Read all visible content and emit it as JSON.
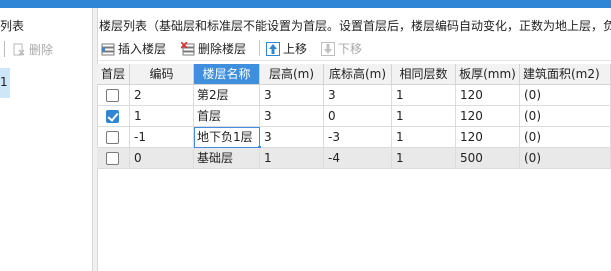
{
  "left_panel": {
    "title": "列表",
    "delete_label": "删除",
    "selected_item": "1"
  },
  "right_panel": {
    "title": "楼层列表（基础层和标准层不能设置为首层。设置首层后，楼层编码自动变化，正数为地上层，负"
  },
  "toolbar": {
    "insert_label": "插入楼层",
    "delete_label": "删除楼层",
    "move_up_label": "上移",
    "move_down_label": "下移"
  },
  "grid": {
    "columns": [
      "首层",
      "编码",
      "楼层名称",
      "层高(m)",
      "底标高(m)",
      "相同层数",
      "板厚(mm)",
      "建筑面积(m2)"
    ],
    "selected_column": "楼层名称",
    "rows": [
      {
        "first_floor": false,
        "code": "2",
        "name": "第2层",
        "height": "3",
        "bottom_elev": "3",
        "same_count": "1",
        "slab": "120",
        "area": "(0)"
      },
      {
        "first_floor": true,
        "code": "1",
        "name": "首层",
        "height": "3",
        "bottom_elev": "0",
        "same_count": "1",
        "slab": "120",
        "area": "(0)"
      },
      {
        "first_floor": false,
        "code": "-1",
        "name": "地下负1层",
        "height": "3",
        "bottom_elev": "-3",
        "same_count": "1",
        "slab": "120",
        "area": "(0)"
      },
      {
        "first_floor": false,
        "code": "0",
        "name": "基础层",
        "height": "1",
        "bottom_elev": "-4",
        "same_count": "1",
        "slab": "500",
        "area": "(0)"
      }
    ]
  }
}
